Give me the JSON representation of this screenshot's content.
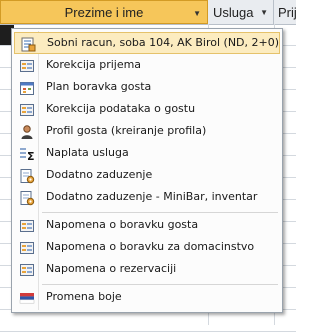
{
  "grid": {
    "columns": [
      {
        "label": "Prezime i ime",
        "active": true
      },
      {
        "label": "Usluga"
      },
      {
        "label": "Prij"
      }
    ]
  },
  "menu": {
    "items": [
      {
        "label": "Sobni racun, soba 104, AK Birol (ND, 2+0)",
        "icon": "receipt-icon",
        "highlighted": true
      },
      {
        "label": "Korekcija prijema",
        "icon": "form-icon"
      },
      {
        "label": "Plan boravka gosta",
        "icon": "calendar-icon"
      },
      {
        "label": "Korekcija podataka o gostu",
        "icon": "form-icon"
      },
      {
        "label": "Profil gosta (kreiranje profila)",
        "icon": "person-icon"
      },
      {
        "label": "Naplata usluga",
        "icon": "sum-icon"
      },
      {
        "label": "Dodatno zaduzenje",
        "icon": "gear-doc-icon"
      },
      {
        "label": "Dodatno zaduzenje - MiniBar, inventar",
        "icon": "gear-doc-icon"
      },
      {
        "label": "Napomena o boravku gosta",
        "icon": "form-icon"
      },
      {
        "label": "Napomena o boravku za domacinstvo",
        "icon": "form-icon"
      },
      {
        "label": "Napomena o rezervaciji",
        "icon": "form-icon"
      },
      {
        "label": "Promena boje",
        "icon": "flag-icon"
      }
    ]
  },
  "colors": {
    "highlight": "#fcecc0",
    "active_header": "#f6c65a"
  }
}
